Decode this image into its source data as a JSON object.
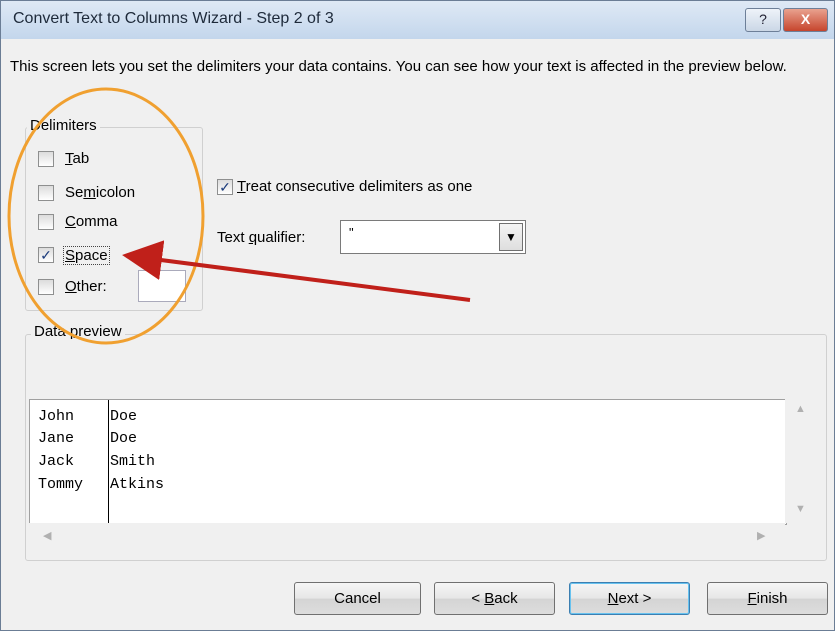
{
  "window": {
    "title": "Convert Text to Columns Wizard - Step 2 of 3",
    "help_label": "?",
    "close_label": "X"
  },
  "description": "This screen lets you set the delimiters your data contains.  You can see how your text is affected in the preview below.",
  "delimiters": {
    "group_label": "Delimiters",
    "items": [
      {
        "pre": "",
        "ul": "T",
        "post": "ab",
        "checked": false
      },
      {
        "pre": "Se",
        "ul": "m",
        "post": "icolon",
        "checked": false
      },
      {
        "pre": "",
        "ul": "C",
        "post": "omma",
        "checked": false
      },
      {
        "pre": "",
        "ul": "S",
        "post": "pace",
        "checked": true
      },
      {
        "pre": "",
        "ul": "O",
        "post": "ther:",
        "checked": false
      }
    ],
    "other_value": ""
  },
  "consecutive": {
    "pre": "",
    "ul": "T",
    "post": "reat consecutive delimiters as one",
    "checked": true
  },
  "qualifier": {
    "pre": "Text ",
    "ul": "q",
    "post": "ualifier:",
    "value": "\""
  },
  "preview": {
    "group_label_pre": "Data ",
    "group_label_ul": "p",
    "group_label_post": "review",
    "rows": [
      {
        "col1": "John",
        "col2": "Doe"
      },
      {
        "col1": "Jane",
        "col2": "Doe"
      },
      {
        "col1": "Jack",
        "col2": "Smith"
      },
      {
        "col1": "Tommy",
        "col2": "Atkins"
      }
    ]
  },
  "buttons": {
    "cancel": "Cancel",
    "back": {
      "pre": "< ",
      "ul": "B",
      "post": "ack"
    },
    "next": {
      "pre": "",
      "ul": "N",
      "post": "ext >"
    },
    "finish": {
      "pre": "",
      "ul": "F",
      "post": "inish"
    }
  },
  "colors": {
    "annotation": "#f0a030",
    "arrow": "#c0201a"
  }
}
